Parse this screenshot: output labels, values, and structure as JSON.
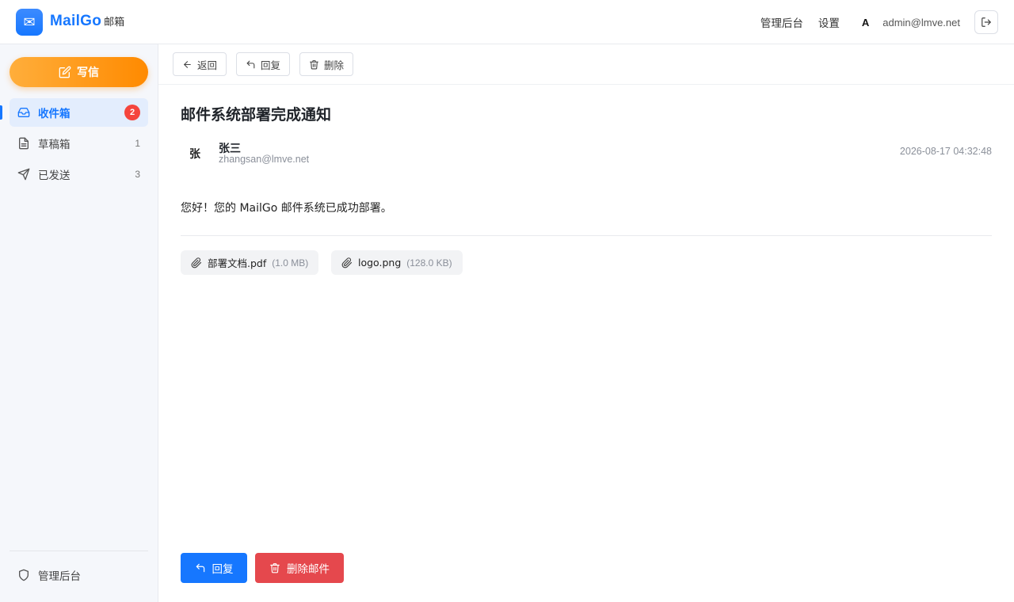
{
  "header": {
    "brand_name": "MailGo",
    "brand_sub": "邮箱",
    "admin_link": "管理后台",
    "settings_link": "设置",
    "avatar_initial": "A",
    "user_email": "admin@lmve.net",
    "logo_icon": "envelope-icon",
    "logout_icon": "logout-icon"
  },
  "sidebar": {
    "compose_label": "写信",
    "items": [
      {
        "label": "收件箱",
        "badge": "2",
        "icon": "inbox-icon"
      },
      {
        "label": "草稿箱",
        "count": "1",
        "icon": "draft-icon"
      },
      {
        "label": "已发送",
        "count": "3",
        "icon": "send-icon"
      }
    ],
    "footer_label": "管理后台",
    "footer_icon": "shield-icon"
  },
  "toolbar": {
    "back_label": "返回",
    "reply_label": "回复",
    "delete_label": "删除"
  },
  "mail": {
    "subject": "邮件系统部署完成通知",
    "sender_initial": "张",
    "sender_name": "张三",
    "sender_email": "zhangsan@lmve.net",
    "date": "2026-08-17 04:32:48",
    "body": "您好！您的 MailGo 邮件系统已成功部署。",
    "attachments": [
      {
        "name": "部署文档.pdf",
        "size": "(1.0 MB)"
      },
      {
        "name": "logo.png",
        "size": "(128.0 KB)"
      }
    ]
  },
  "footer_actions": {
    "reply_label": "回复",
    "delete_label": "删除邮件"
  },
  "colors": {
    "primary": "#1677ff",
    "compose_orange": "#ff8a00",
    "danger": "#e5484d",
    "badge_red": "#f5453d"
  }
}
